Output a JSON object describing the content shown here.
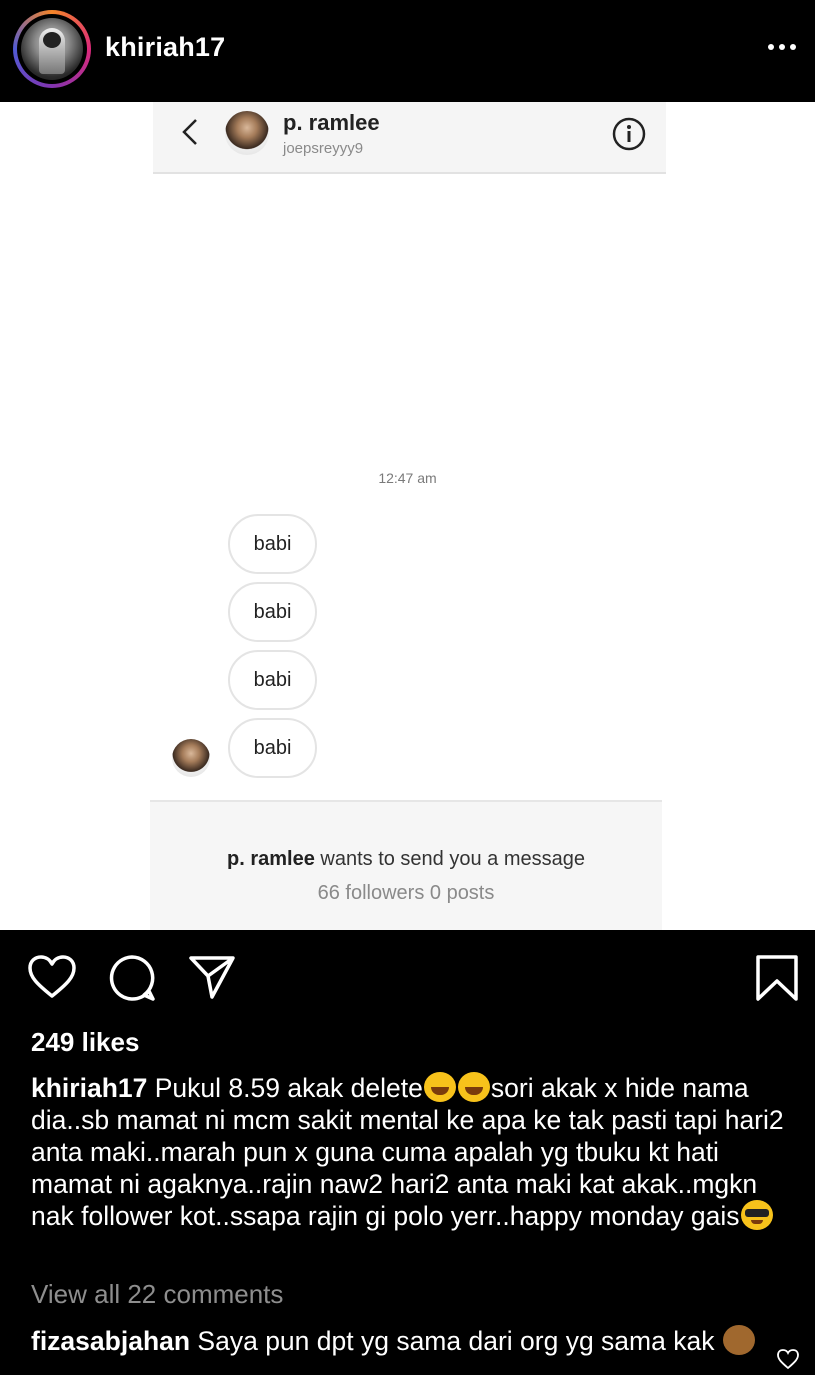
{
  "header": {
    "username": "khiriah17"
  },
  "dm": {
    "name": "p. ramlee",
    "handle": "joepsreyyy9",
    "timestamp": "12:47 am",
    "messages": [
      "babi",
      "babi",
      "babi",
      "babi"
    ],
    "request_name": "p. ramlee",
    "request_text": " wants to send you a message",
    "request_stats": "66 followers 0 posts"
  },
  "post": {
    "likes": "249 likes",
    "caption_user": "khiriah17",
    "caption_part1": " Pukul 8.59 akak delete",
    "caption_part2": "sori akak x hide nama dia..sb mamat ni mcm sakit mental ke apa ke tak pasti tapi hari2 anta maki..marah pun x guna cuma apalah yg tbuku kt hati mamat ni agaknya..rajin naw2 hari2 anta maki kat akak..mgkn nak follower kot..ssapa rajin gi polo yerr..happy monday gais",
    "view_comments": "View all 22 comments",
    "comment_user": "fizasabjahan",
    "comment_text": " Saya pun dpt yg sama dari org yg sama kak "
  },
  "icons": {
    "more": "more-icon",
    "like": "heart-icon",
    "comment": "comment-icon",
    "share": "send-icon",
    "save": "bookmark-icon"
  }
}
